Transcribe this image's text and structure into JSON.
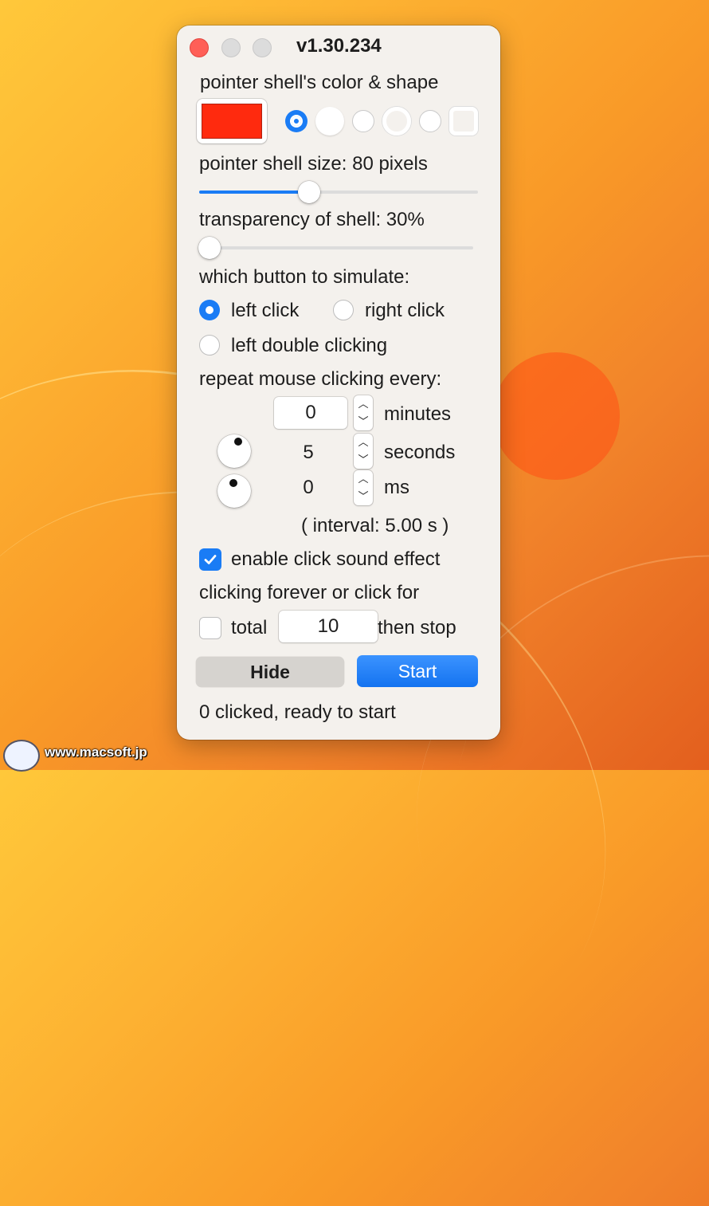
{
  "window": {
    "title": "v1.30.234"
  },
  "shell": {
    "color_shape_label": "pointer shell's color & shape",
    "color": "#ff2a0e",
    "shapes": [
      "circle-dot-selected",
      "filled-circle",
      "small-circle",
      "ring",
      "small-circle",
      "rounded-square"
    ],
    "selected_shape_index": 0,
    "size_label": "pointer shell size: 80 pixels",
    "size_slider_fraction": 0.39,
    "transparency_label": "transparency of shell: 30%",
    "transparency_slider_fraction": 0.0
  },
  "buttons_section": {
    "label": "which button to simulate:",
    "options": [
      "left click",
      "right click",
      "left double clicking"
    ],
    "selected": "left click"
  },
  "repeat": {
    "label": "repeat mouse clicking every:",
    "minutes_value": "0",
    "minutes_label": "minutes",
    "seconds_value": "5",
    "seconds_label": "seconds",
    "ms_value": "0",
    "ms_label": "ms",
    "interval_text": "( interval: 5.00 s )"
  },
  "sound": {
    "label": "enable click sound effect",
    "checked": true
  },
  "limit": {
    "label": "clicking forever or click for",
    "checkbox_label": "total",
    "total_value": "10",
    "suffix": "then stop",
    "checked": false
  },
  "actions": {
    "hide_label": "Hide",
    "start_label": "Start"
  },
  "status": {
    "text": "0 clicked, ready to start"
  },
  "watermark": {
    "text": "www.macsoft.jp"
  },
  "colors": {
    "accent": "#1a7cf5",
    "close": "#ff5f57",
    "shell_overlay": "#ff5014"
  }
}
